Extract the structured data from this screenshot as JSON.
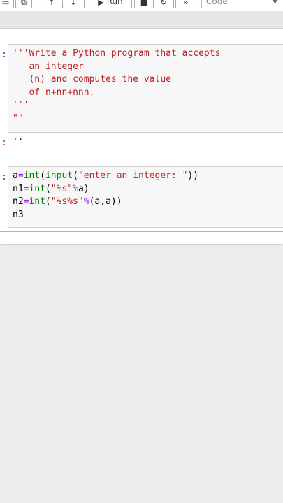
{
  "toolbar": {
    "run_label": "Run",
    "cell_type": "Code",
    "buttons": [
      "copy-icon",
      "up-icon",
      "down-icon",
      "play-icon",
      "stop-icon",
      "restart-icon",
      "fast-forward-icon"
    ]
  },
  "cells": [
    {
      "prompt": ":",
      "lines": [
        "'''Write a Python program that accepts",
        "   an integer",
        "   (n) and computes the value",
        "   of n+nn+nnn.",
        "'''",
        "\"\""
      ]
    },
    {
      "prompt": ":",
      "output": "''"
    },
    {
      "prompt": ":",
      "lines": [
        "a=int(input(\"enter an integer: \"))",
        "n1=int(\"%s\"%a)",
        "n2=int(\"%s%s\"%(a,a))",
        "n3"
      ]
    }
  ],
  "colors": {
    "string": "#ba2121",
    "builtin": "#008000",
    "operator": "#aa22ff",
    "prompt": "#303f9f",
    "divider": "#5cb85c"
  }
}
